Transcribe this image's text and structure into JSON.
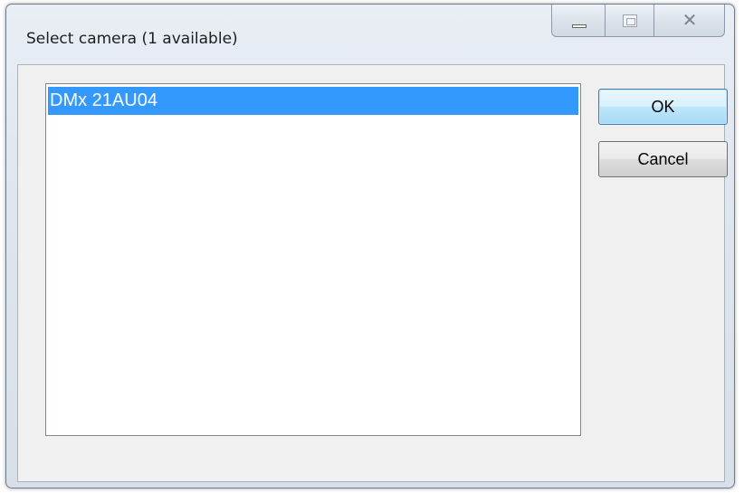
{
  "window": {
    "title": "Select camera (1 available)",
    "caption_buttons": {
      "minimize_icon": "minimize-icon",
      "maximize_icon": "maximize-icon",
      "close_icon": "close-icon",
      "close_glyph": "✕"
    }
  },
  "camera_list": {
    "items": [
      {
        "label": "DMx 21AU04",
        "selected": true
      }
    ],
    "selection_color": "#3399ff"
  },
  "buttons": {
    "ok_label": "OK",
    "cancel_label": "Cancel"
  }
}
